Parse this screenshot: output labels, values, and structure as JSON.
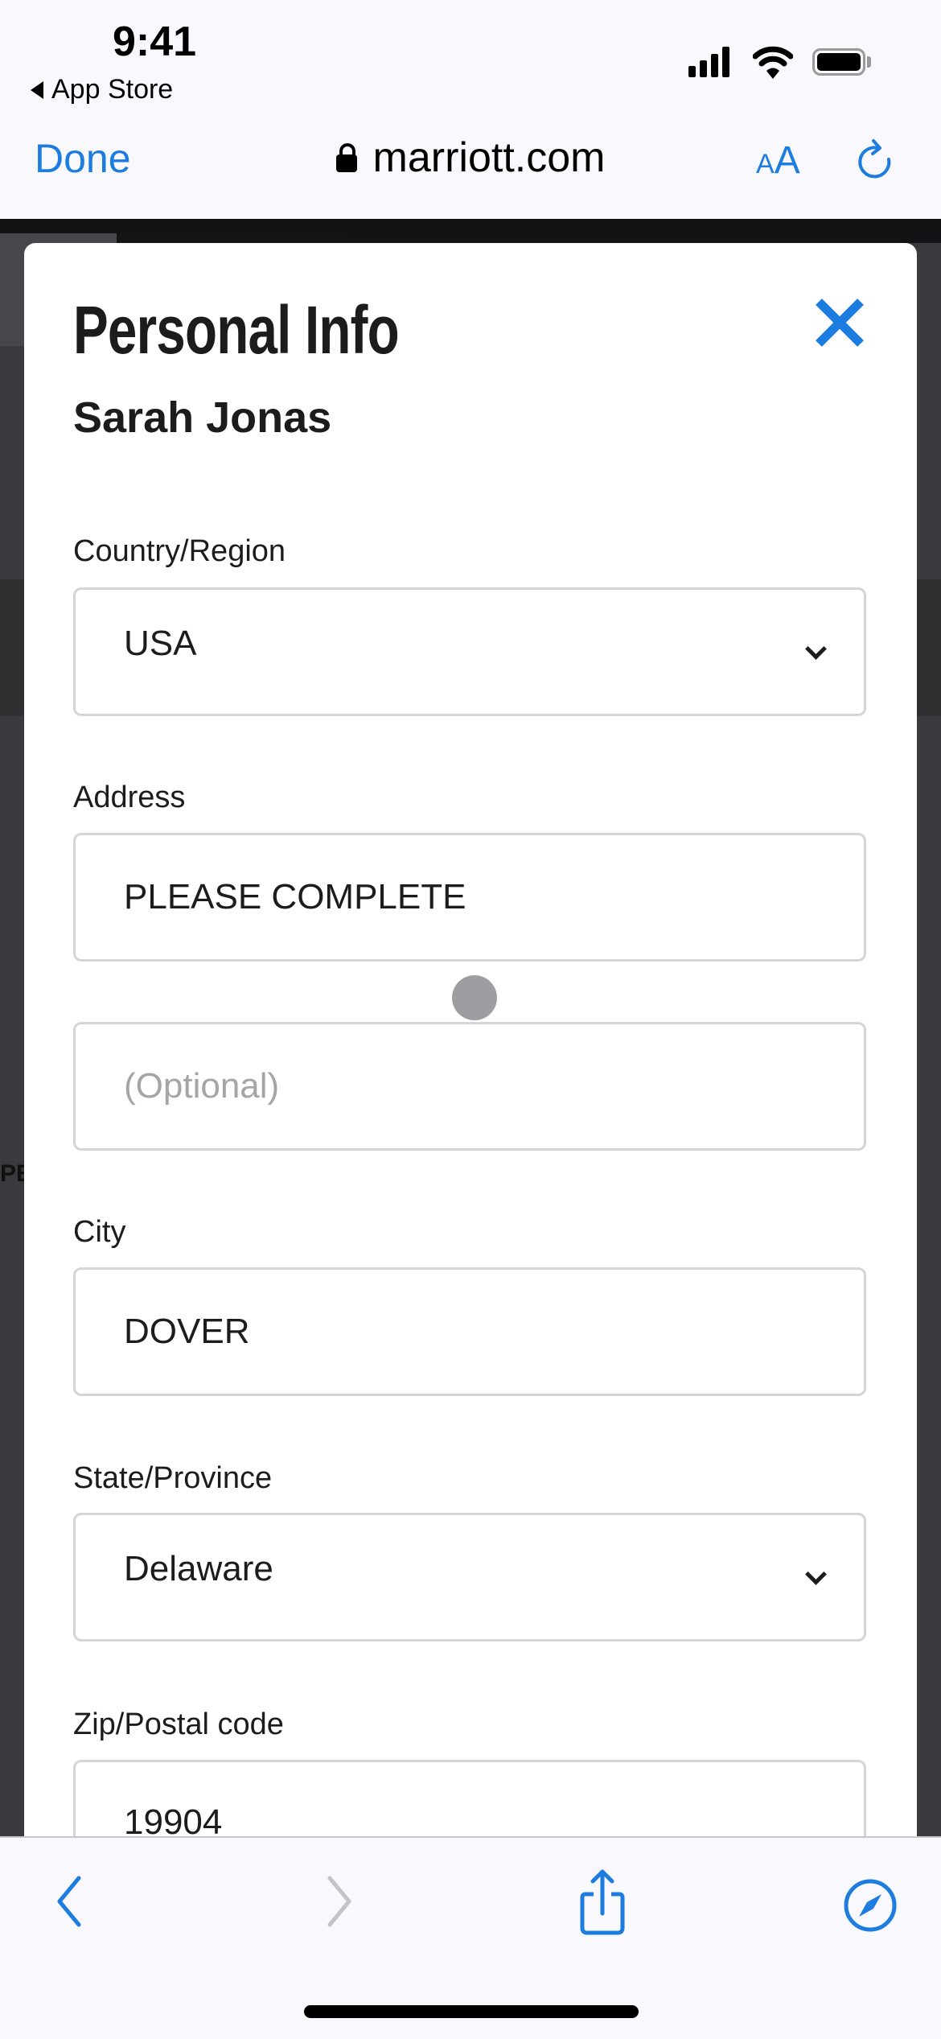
{
  "status_bar": {
    "time": "9:41",
    "back_app_label": "App Store",
    "icons": [
      "cellular-signal-icon",
      "wifi-icon",
      "battery-icon"
    ]
  },
  "browser": {
    "done_label": "Done",
    "url": "marriott.com",
    "text_size_label_small": "A",
    "text_size_label_large": "A",
    "accent_color": "#1c7ce0"
  },
  "background": {
    "partial_text": "PE"
  },
  "modal": {
    "title": "Personal Info",
    "member_name": "Sarah Jonas",
    "fields": [
      {
        "label": "Country/Region",
        "type": "select",
        "value": "USA"
      },
      {
        "label": "Address",
        "type": "text",
        "value": "PLEASE COMPLETE"
      },
      {
        "label": "",
        "type": "text",
        "value": "",
        "placeholder": "(Optional)"
      },
      {
        "label": "City",
        "type": "text",
        "value": "DOVER"
      },
      {
        "label": "State/Province",
        "type": "select",
        "value": "Delaware"
      },
      {
        "label": "Zip/Postal code",
        "type": "text",
        "value": "19904"
      }
    ]
  },
  "toolbar": {
    "items": [
      "back",
      "forward",
      "share",
      "open-in-safari"
    ],
    "forward_enabled": false
  }
}
